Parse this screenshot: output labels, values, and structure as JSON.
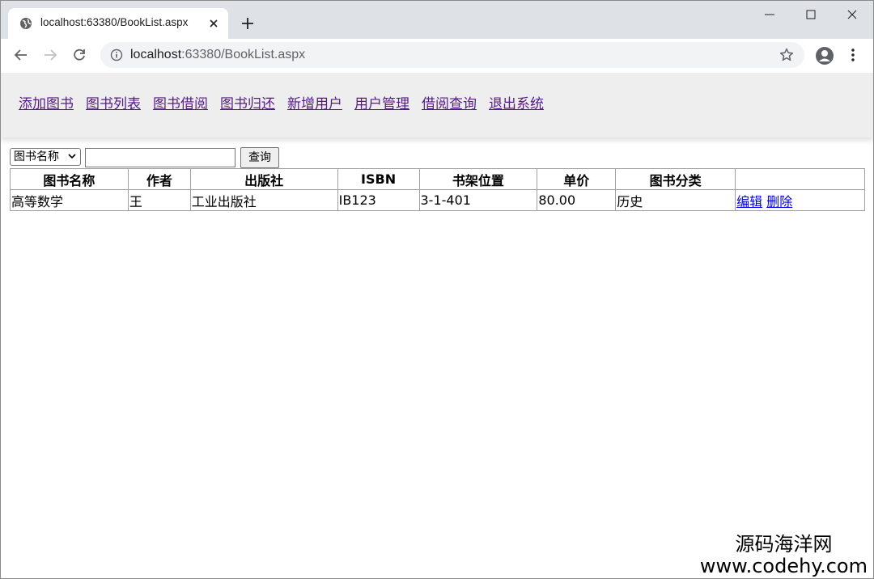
{
  "browser": {
    "tab_title": "localhost:63380/BookList.aspx",
    "url_host": "localhost",
    "url_rest": ":63380/BookList.aspx"
  },
  "navbar": {
    "links": [
      "添加图书",
      "图书列表",
      "图书借阅",
      "图书归还",
      "新增用户",
      "用户管理",
      "借阅查询",
      "退出系统"
    ]
  },
  "search": {
    "field_selected": "图书名称",
    "input_value": "",
    "button_label": "查询"
  },
  "table": {
    "headers": [
      "图书名称",
      "作者",
      "出版社",
      "ISBN",
      "书架位置",
      "单价",
      "图书分类",
      ""
    ],
    "rows": [
      {
        "name": "高等数学",
        "author": "王",
        "publisher": "工业出版社",
        "isbn": "IB123",
        "shelf": "3-1-401",
        "price": "80.00",
        "category": "历史",
        "edit_label": "编辑",
        "delete_label": "删除"
      }
    ]
  },
  "watermark": {
    "cn": "源码海洋网",
    "url": "www.codehy.com"
  },
  "colors": {
    "tabstrip": "#dee1e6",
    "navbar_bg": "#eeeeee",
    "visited_link": "#551a8b",
    "link": "#0000ee"
  }
}
